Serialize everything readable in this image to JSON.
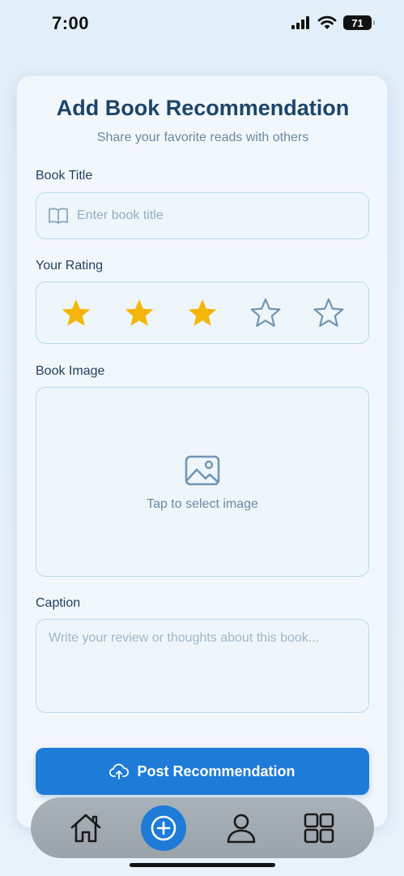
{
  "status_bar": {
    "time": "7:00",
    "battery": "71"
  },
  "form": {
    "title": "Add Book Recommendation",
    "subtitle": "Share your favorite reads with others",
    "book_title_label": "Book Title",
    "book_title_placeholder": "Enter book title",
    "book_title_value": "",
    "rating_label": "Your Rating",
    "rating": {
      "value": 3,
      "max": 5
    },
    "image_label": "Book Image",
    "image_prompt": "Tap to select image",
    "caption_label": "Caption",
    "caption_placeholder": "Write your review or thoughts about this book...",
    "caption_value": "",
    "post_button_label": "Post Recommendation"
  },
  "nav": {
    "items": [
      {
        "name": "home",
        "icon": "home-icon"
      },
      {
        "name": "add",
        "icon": "plus-circle-icon",
        "active": true
      },
      {
        "name": "profile",
        "icon": "user-icon"
      },
      {
        "name": "grid",
        "icon": "grid-icon"
      }
    ]
  },
  "colors": {
    "accent": "#1e7bd8",
    "star_filled": "#f5b50a",
    "star_empty": "#6f96b3",
    "title": "#1c4569"
  }
}
